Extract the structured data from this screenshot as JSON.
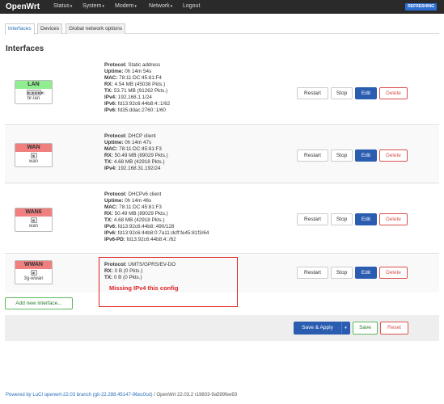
{
  "nav": {
    "brand": "OpenWrt",
    "items": [
      "Status",
      "System",
      "Modem",
      "Network",
      "Logout"
    ],
    "badge": "REFRESHING"
  },
  "tabs": [
    "Interfaces",
    "Devices",
    "Global network options"
  ],
  "section_title": "Interfaces",
  "interfaces": [
    {
      "name": "LAN",
      "device": "br-lan",
      "icon_text": "▣(▣▣▣▣)",
      "lines": [
        {
          "label": "Protocol:",
          "value": " Static address"
        },
        {
          "label": "Uptime:",
          "value": " 0h 14m 54s"
        },
        {
          "label": "MAC:",
          "value": " 78:11:DC:45:81:F4"
        },
        {
          "label": "RX:",
          "value": " 4.54 MB (45038 Pkts.)"
        },
        {
          "label": "TX:",
          "value": " 53.71 MB (91262 Pkts.)"
        },
        {
          "label": "IPv4:",
          "value": " 192.168.1.1/24"
        },
        {
          "label": "IPv6:",
          "value": " fd13:92c6:44b8:4::1/62"
        },
        {
          "label": "IPv6:",
          "value": " fd35:ddac:2760::1/60"
        }
      ]
    },
    {
      "name": "WAN",
      "device": "wan",
      "icon_text": "▣",
      "lines": [
        {
          "label": "Protocol:",
          "value": " DHCP client"
        },
        {
          "label": "Uptime:",
          "value": " 0h 14m 47s"
        },
        {
          "label": "MAC:",
          "value": " 78:11:DC:45:81:F3"
        },
        {
          "label": "RX:",
          "value": " 50.49 MB (89029 Pkts.)"
        },
        {
          "label": "TX:",
          "value": " 4.68 MB (42918 Pkts.)"
        },
        {
          "label": "IPv4:",
          "value": " 192.168.31.192/24"
        }
      ]
    },
    {
      "name": "WAN6",
      "device": "wan",
      "icon_text": "▣",
      "lines": [
        {
          "label": "Protocol:",
          "value": " DHCPv6 client"
        },
        {
          "label": "Uptime:",
          "value": " 0h 14m 46s"
        },
        {
          "label": "MAC:",
          "value": " 78:11:DC:45:81:F3"
        },
        {
          "label": "RX:",
          "value": " 50.49 MB (89029 Pkts.)"
        },
        {
          "label": "TX:",
          "value": " 4.68 MB (42918 Pkts.)"
        },
        {
          "label": "IPv6:",
          "value": " fd13:92c6:44b8::490/128"
        },
        {
          "label": "IPv6:",
          "value": " fd13:92c6:44b8:0:7a11:dcff:fe45:81f3/64"
        },
        {
          "label": "IPv6-PD:",
          "value": " fd13:92c6:44b8:4::/62"
        }
      ]
    },
    {
      "name": "WWAN",
      "device": "3g-wwan",
      "icon_text": "▣",
      "lines": [
        {
          "label": "Protocol:",
          "value": " UMTS/GPRS/EV-DO"
        },
        {
          "label": "RX:",
          "value": " 0 B (0 Pkts.)"
        },
        {
          "label": "TX:",
          "value": " 0 B (0 Pkts.)"
        }
      ]
    }
  ],
  "row_buttons": {
    "restart": "Restart",
    "stop": "Stop",
    "edit": "Edit",
    "delete": "Delete"
  },
  "annotation": "Missing IPv4 this config",
  "add_interface": "Add new interface...",
  "footer": {
    "save_apply": "Save & Apply",
    "save": "Save",
    "reset": "Reset"
  },
  "powered": {
    "prefix": "Powered by ",
    "link": "LuCI openwrt-22.03 branch (git-22.288.45147-96ec0cd)",
    "suffix": " / OpenWrt 22.03.2 r19803-9a599fee93"
  },
  "colors": {
    "navbar": "#2a2a2a",
    "edit_button": "#2a5db0",
    "delete_button": "#d9534f",
    "annotation": "#dd2222",
    "lan_header": "#90ee90",
    "wan_header": "#f08080"
  }
}
